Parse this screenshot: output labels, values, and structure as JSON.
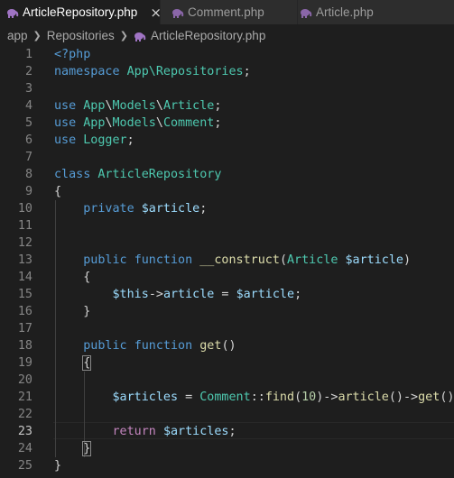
{
  "tabs": [
    {
      "label": "ArticleRepository.php",
      "active": true,
      "close": "×"
    },
    {
      "label": "Comment.php",
      "active": false
    },
    {
      "label": "Article.php",
      "active": false
    }
  ],
  "breadcrumb": {
    "items": [
      "app",
      "Repositories",
      "ArticleRepository.php"
    ]
  },
  "colors": {
    "keyword": "#569cd6",
    "control": "#c586c0",
    "type": "#4ec9b0",
    "variable": "#9cdcfe",
    "function": "#dcdcaa",
    "number": "#b5cea8",
    "plain": "#d4d4d4",
    "php_icon": "#a074c4"
  },
  "editor": {
    "current_line": 23,
    "lines": [
      {
        "n": "1",
        "tokens": [
          [
            "<?php",
            "blue"
          ]
        ]
      },
      {
        "n": "2",
        "tokens": [
          [
            "namespace ",
            "blue"
          ],
          [
            "App\\Repositories",
            "teal"
          ],
          [
            ";",
            "plain"
          ]
        ]
      },
      {
        "n": "3",
        "tokens": []
      },
      {
        "n": "4",
        "tokens": [
          [
            "use ",
            "blue"
          ],
          [
            "App",
            "teal"
          ],
          [
            "\\",
            "plain"
          ],
          [
            "Models",
            "teal"
          ],
          [
            "\\",
            "plain"
          ],
          [
            "Article",
            "teal"
          ],
          [
            ";",
            "plain"
          ]
        ]
      },
      {
        "n": "5",
        "tokens": [
          [
            "use ",
            "blue"
          ],
          [
            "App",
            "teal"
          ],
          [
            "\\",
            "plain"
          ],
          [
            "Models",
            "teal"
          ],
          [
            "\\",
            "plain"
          ],
          [
            "Comment",
            "teal"
          ],
          [
            ";",
            "plain"
          ]
        ]
      },
      {
        "n": "6",
        "tokens": [
          [
            "use ",
            "blue"
          ],
          [
            "Logger",
            "teal"
          ],
          [
            ";",
            "plain"
          ]
        ]
      },
      {
        "n": "7",
        "tokens": []
      },
      {
        "n": "8",
        "tokens": [
          [
            "class ",
            "blue"
          ],
          [
            "ArticleRepository",
            "teal"
          ]
        ]
      },
      {
        "n": "9",
        "tokens": [
          [
            "{",
            "plain"
          ]
        ]
      },
      {
        "n": "10",
        "tokens": [
          [
            "    ",
            "plain"
          ],
          [
            "private ",
            "blue"
          ],
          [
            "$article",
            "var"
          ],
          [
            ";",
            "plain"
          ]
        ]
      },
      {
        "n": "11",
        "tokens": []
      },
      {
        "n": "12",
        "tokens": []
      },
      {
        "n": "13",
        "tokens": [
          [
            "    ",
            "plain"
          ],
          [
            "public ",
            "blue"
          ],
          [
            "function ",
            "blue"
          ],
          [
            "__construct",
            "fn"
          ],
          [
            "(",
            "plain"
          ],
          [
            "Article ",
            "teal"
          ],
          [
            "$article",
            "var"
          ],
          [
            ")",
            "plain"
          ]
        ]
      },
      {
        "n": "14",
        "tokens": [
          [
            "    ",
            "plain"
          ],
          [
            "{",
            "plain"
          ]
        ]
      },
      {
        "n": "15",
        "tokens": [
          [
            "        ",
            "plain"
          ],
          [
            "$this",
            "var"
          ],
          [
            "->",
            "plain"
          ],
          [
            "article",
            "var"
          ],
          [
            " = ",
            "plain"
          ],
          [
            "$article",
            "var"
          ],
          [
            ";",
            "plain"
          ]
        ]
      },
      {
        "n": "16",
        "tokens": [
          [
            "    ",
            "plain"
          ],
          [
            "}",
            "plain"
          ]
        ]
      },
      {
        "n": "17",
        "tokens": []
      },
      {
        "n": "18",
        "tokens": [
          [
            "    ",
            "plain"
          ],
          [
            "public ",
            "blue"
          ],
          [
            "function ",
            "blue"
          ],
          [
            "get",
            "fn"
          ],
          [
            "()",
            "plain"
          ]
        ]
      },
      {
        "n": "19",
        "tokens": [
          [
            "    ",
            "plain"
          ],
          [
            "{",
            "plain",
            "box"
          ]
        ]
      },
      {
        "n": "20",
        "tokens": []
      },
      {
        "n": "21",
        "tokens": [
          [
            "        ",
            "plain"
          ],
          [
            "$articles",
            "var"
          ],
          [
            " = ",
            "plain"
          ],
          [
            "Comment",
            "teal"
          ],
          [
            "::",
            "plain"
          ],
          [
            "find",
            "fn"
          ],
          [
            "(",
            "plain"
          ],
          [
            "10",
            "num"
          ],
          [
            ")->",
            "plain"
          ],
          [
            "article",
            "fn"
          ],
          [
            "()->",
            "plain"
          ],
          [
            "get",
            "fn"
          ],
          [
            "();",
            "plain"
          ]
        ]
      },
      {
        "n": "22",
        "tokens": []
      },
      {
        "n": "23",
        "tokens": [
          [
            "        ",
            "plain"
          ],
          [
            "return ",
            "purple"
          ],
          [
            "$articles",
            "var"
          ],
          [
            ";",
            "plain"
          ]
        ]
      },
      {
        "n": "24",
        "tokens": [
          [
            "    ",
            "plain"
          ],
          [
            "}",
            "plain",
            "box"
          ]
        ]
      },
      {
        "n": "25",
        "tokens": [
          [
            "}",
            "plain"
          ]
        ]
      }
    ]
  }
}
